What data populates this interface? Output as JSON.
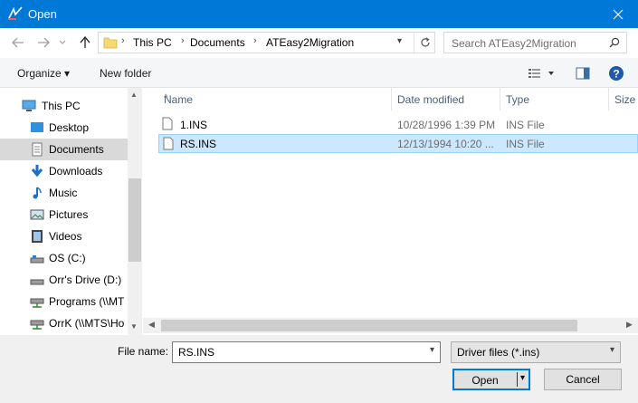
{
  "window": {
    "title": "Open",
    "close_icon": "close-icon"
  },
  "colors": {
    "titlebar": "#0078d7",
    "selection": "#cce8ff",
    "selection_border": "#99d1ff",
    "nav_selected": "#d9d9d9",
    "link": "#1e3287"
  },
  "address": {
    "crumbs": [
      "This PC",
      "Documents",
      "ATEasy2Migration"
    ],
    "search_placeholder": "Search ATEasy2Migration"
  },
  "toolbar": {
    "organize_label": "Organize ▾",
    "new_folder_label": "New folder"
  },
  "nav": {
    "items": [
      {
        "label": "This PC",
        "icon": "computer-icon"
      },
      {
        "label": "Desktop",
        "icon": "desktop-icon"
      },
      {
        "label": "Documents",
        "icon": "documents-icon"
      },
      {
        "label": "Downloads",
        "icon": "downloads-icon"
      },
      {
        "label": "Music",
        "icon": "music-icon"
      },
      {
        "label": "Pictures",
        "icon": "pictures-icon"
      },
      {
        "label": "Videos",
        "icon": "videos-icon"
      },
      {
        "label": "OS (C:)",
        "icon": "drive-icon"
      },
      {
        "label": "Orr's Drive (D:)",
        "icon": "drive-icon"
      },
      {
        "label": "Programs (\\\\MT",
        "icon": "network-drive-icon"
      },
      {
        "label": "OrrK (\\\\MTS\\Ho",
        "icon": "network-drive-icon"
      }
    ]
  },
  "files": {
    "columns": [
      "Name",
      "Date modified",
      "Type",
      "Size"
    ],
    "rows": [
      {
        "name": "1.INS",
        "date": "10/28/1996 1:39 PM",
        "type": "INS File"
      },
      {
        "name": "RS.INS",
        "date": "12/13/1994 10:20 ...",
        "type": "INS File"
      }
    ]
  },
  "bottom": {
    "file_name_label": "File name:",
    "file_name_value": "RS.INS",
    "filter_value": "Driver files (*.ins)",
    "open_label": "Open",
    "cancel_label": "Cancel"
  }
}
